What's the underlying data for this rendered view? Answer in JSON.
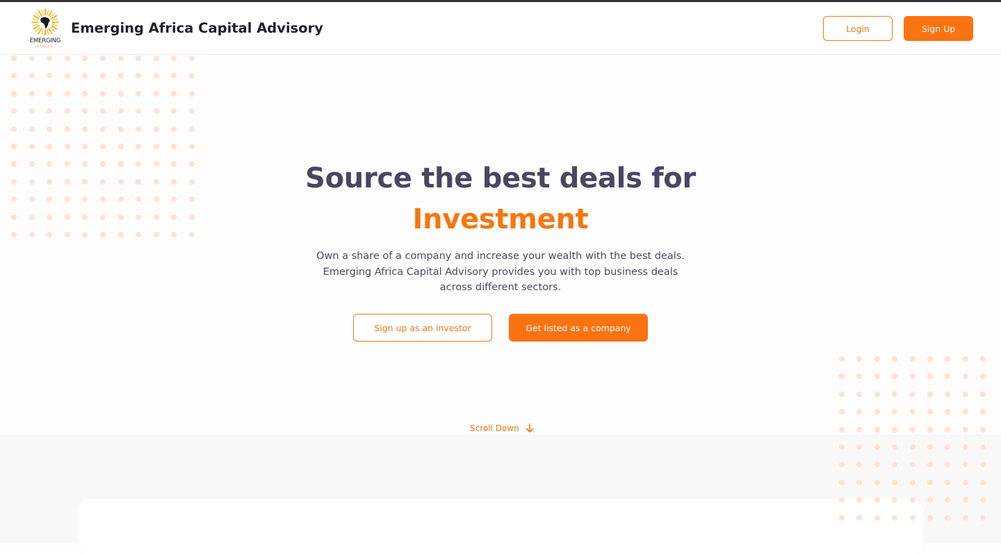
{
  "header": {
    "logo_word": "EMERGING",
    "logo_sub": "AFRICA",
    "brand": "Emerging Africa Capital Advisory",
    "login_label": "Login",
    "signup_label": "Sign Up"
  },
  "hero": {
    "title_line1": "Source the best deals for",
    "title_line2": "Investment",
    "description": "Own a share of a company and increase your wealth with the best deals. Emerging Africa Capital Advisory provides you with top business deals across different sectors.",
    "investor_button": "Sign up as an investor",
    "company_button": "Get listed as a company",
    "scroll_label": "Scroll Down",
    "scroll_icon": "arrow-down-icon"
  },
  "colors": {
    "accent": "#fb7310",
    "heading": "#4a4660",
    "dots": "#fde3d3"
  }
}
